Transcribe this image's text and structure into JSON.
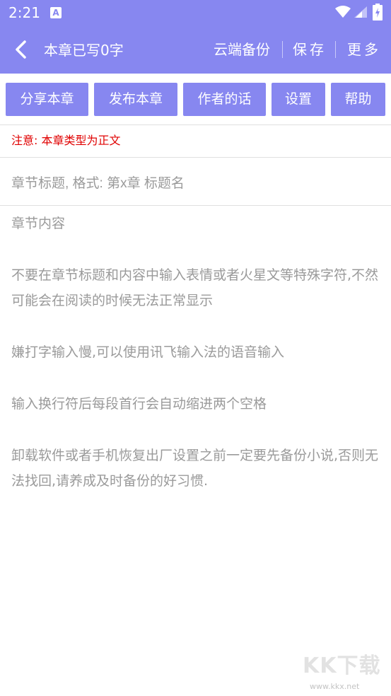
{
  "status_bar": {
    "time": "2:21",
    "notification_badge": "A",
    "icons": [
      "wifi-icon",
      "signal-icon",
      "battery-icon"
    ]
  },
  "appbar": {
    "title": "本章已写0字",
    "actions": {
      "backup": "云端备份",
      "save": "保存",
      "more": "更多"
    }
  },
  "toolbar": {
    "buttons": [
      "分享本章",
      "发布本章",
      "作者的话",
      "设置",
      "帮助"
    ]
  },
  "notice": "注意: 本章类型为正文",
  "chapter_title": {
    "value": "",
    "placeholder": "章节标题, 格式: 第x章 标题名"
  },
  "content": {
    "heading": "章节内容",
    "tips": [
      "不要在章节标题和内容中输入表情或者火星文等特殊字符,不然可能会在阅读的时候无法正常显示",
      "嫌打字输入慢,可以使用讯飞输入法的语音输入",
      "输入换行符后每段首行会自动缩进两个空格",
      "卸载软件或者手机恢复出厂设置之前一定要先备份小说,否则无法找回,请养成及时备份的好习惯."
    ]
  },
  "watermark": {
    "text": "KK下载",
    "url": "www.kkx.net"
  },
  "colors": {
    "accent": "#8787f0",
    "warning": "#e00000",
    "placeholder": "#9a9a9a"
  }
}
